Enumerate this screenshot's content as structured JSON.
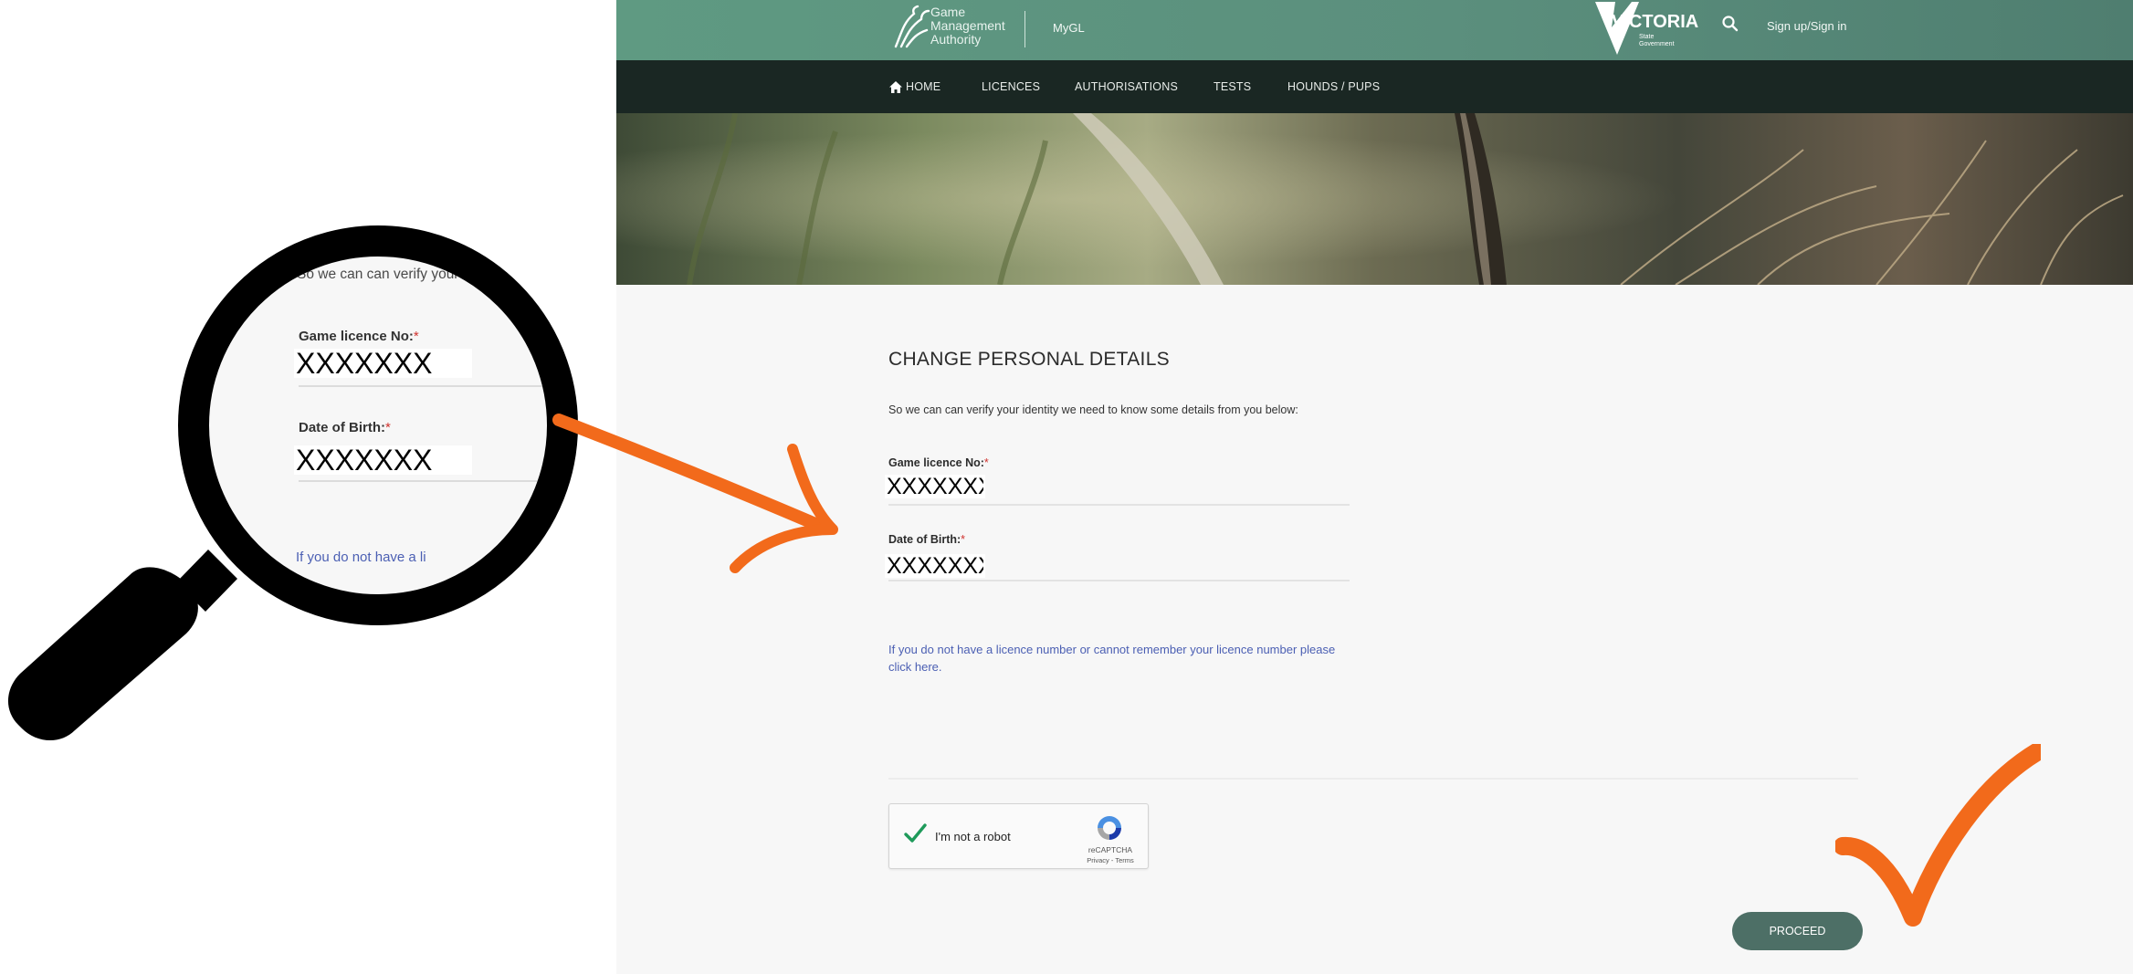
{
  "header": {
    "logo_line1": "Game",
    "logo_line2": "Management",
    "logo_line3": "Authority",
    "app_name": "MyGL",
    "gov_logo_text": "VICTORIA",
    "gov_logo_sub1": "State",
    "gov_logo_sub2": "Government",
    "signin_label": "Sign up/Sign in",
    "search_icon": "search-icon"
  },
  "nav": {
    "items": [
      {
        "label": "HOME",
        "icon": "home-icon"
      },
      {
        "label": "LICENCES"
      },
      {
        "label": "AUTHORISATIONS"
      },
      {
        "label": "TESTS"
      },
      {
        "label": "HOUNDS / PUPS"
      }
    ]
  },
  "form": {
    "title": "CHANGE PERSONAL DETAILS",
    "intro": "So we can can verify your identity we need to know some details from you below:",
    "licence_label": "Game licence No:",
    "licence_value": "XXXXXXX",
    "dob_label": "Date of Birth:",
    "dob_value": "XXXXXXX",
    "required_marker": "*",
    "help_link": "If you do not have a licence number or cannot remember your licence number please click here.",
    "captcha_label": "I'm not a robot",
    "captcha_brand": "reCAPTCHA",
    "captcha_terms": "Privacy - Terms",
    "proceed_label": "PROCEED"
  },
  "zoom": {
    "intro_fragment": "So we can can verify your",
    "licence_label": "Game licence No:",
    "licence_value": "XXXXXXX",
    "dob_label": "Date of Birth:",
    "dob_value": "XXXXXXX",
    "link_fragment": "If you do not have a li"
  },
  "colors": {
    "header_green": "#5f9a82",
    "nav_dark": "#1a2723",
    "proceed_button": "#4d6f66",
    "annotation_orange": "#f26a1b",
    "link_blue": "#4b5fb3",
    "required_red": "#d0332f"
  }
}
